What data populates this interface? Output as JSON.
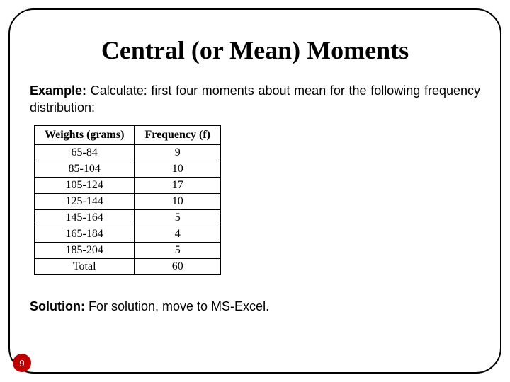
{
  "title": "Central (or Mean) Moments",
  "example": {
    "label": "Example:",
    "text": "  Calculate: first four moments about mean for the following frequency distribution:"
  },
  "table": {
    "headers": {
      "col1": "Weights (grams)",
      "col2": "Frequency (f)"
    },
    "rows": [
      {
        "weights": "65-84",
        "freq": "9"
      },
      {
        "weights": "85-104",
        "freq": "10"
      },
      {
        "weights": "105-124",
        "freq": "17"
      },
      {
        "weights": "125-144",
        "freq": "10"
      },
      {
        "weights": "145-164",
        "freq": "5"
      },
      {
        "weights": "165-184",
        "freq": "4"
      },
      {
        "weights": "185-204",
        "freq": "5"
      },
      {
        "weights": "Total",
        "freq": "60"
      }
    ]
  },
  "solution": {
    "label": "Solution:",
    "text": " For solution, move to MS-Excel."
  },
  "page_number": "9"
}
